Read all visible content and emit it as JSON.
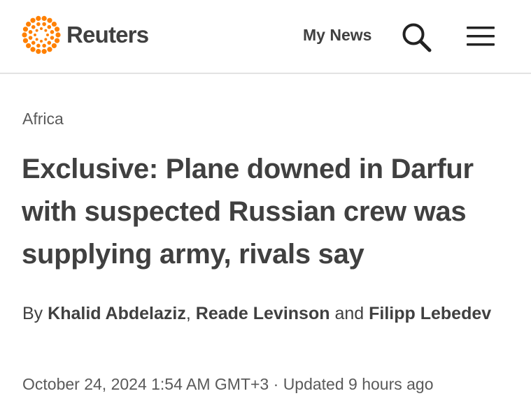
{
  "header": {
    "brand": "Reuters",
    "brand_color": "#ff8000",
    "my_news_label": "My News",
    "search_icon": "search-icon",
    "menu_icon": "menu-icon"
  },
  "article": {
    "section": "Africa",
    "headline": "Exclusive: Plane downed in Darfur with suspected Russian crew was supplying army, rivals say",
    "byline": {
      "prefix": "By",
      "authors": [
        "Khalid Abdelaziz",
        "Reade Levinson",
        "Filipp Lebedev"
      ],
      "separator": ",",
      "conjunction": "and"
    },
    "published": "October 24, 2024 1:54 AM GMT+3",
    "dot": "·",
    "updated": "Updated 9 hours ago"
  }
}
